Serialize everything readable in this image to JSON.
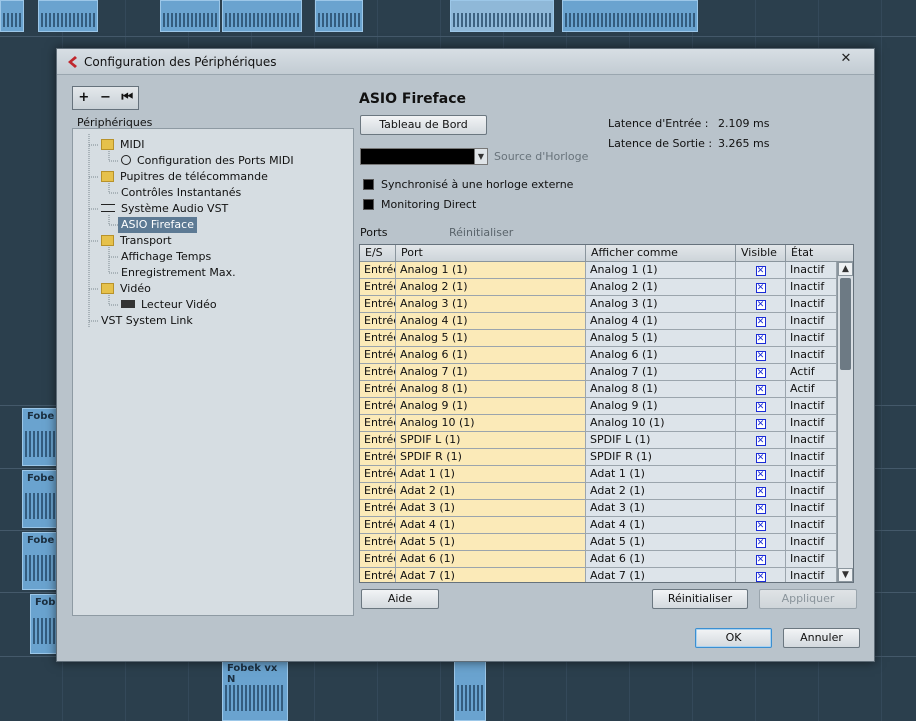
{
  "background": {
    "clip_labels": [
      "Fobe",
      "Fobe",
      "Fobe",
      "Fobe",
      "Fobek vx N"
    ]
  },
  "dialog": {
    "title": "Configuration des Périphériques",
    "close_label": "✕",
    "toolbar": {
      "add": "+",
      "remove": "−",
      "reset": "⏮"
    }
  },
  "tree": {
    "title": "Périphériques",
    "items": [
      {
        "label": "MIDI",
        "icon": "folder-icon"
      },
      {
        "label": "Configuration des Ports MIDI",
        "icon": "clock-icon"
      },
      {
        "label": "Pupitres de télécommande",
        "icon": "folder-icon"
      },
      {
        "label": "Contrôles Instantanés",
        "icon": ""
      },
      {
        "label": "Système Audio VST",
        "icon": "vst-icon"
      },
      {
        "label": "ASIO Fireface",
        "icon": ""
      },
      {
        "label": "Transport",
        "icon": "folder-icon"
      },
      {
        "label": "Affichage Temps",
        "icon": ""
      },
      {
        "label": "Enregistrement Max.",
        "icon": ""
      },
      {
        "label": "Vidéo",
        "icon": "folder-icon"
      },
      {
        "label": "Lecteur Vidéo",
        "icon": "video-icon"
      },
      {
        "label": "VST System Link",
        "icon": ""
      }
    ]
  },
  "device": {
    "title": "ASIO Fireface",
    "control_panel_button": "Tableau de Bord",
    "input_latency_label": "Latence d'Entrée :",
    "input_latency_value": "2.109 ms",
    "output_latency_label": "Latence de Sortie :",
    "output_latency_value": "3.265 ms",
    "clock_source_label": "Source d'Horloge",
    "sync_external_label": "Synchronisé à une horloge externe",
    "direct_monitoring_label": "Monitoring Direct",
    "ports_label": "Ports",
    "reset_label": "Réinitialiser"
  },
  "table": {
    "headers": {
      "io": "E/S",
      "port": "Port",
      "display": "Afficher comme",
      "visible": "Visible",
      "state": "État"
    },
    "rows": [
      {
        "io": "Entrée",
        "port": "Analog 1 (1)",
        "display": "Analog 1 (1)",
        "visible": "✕",
        "state": "Inactif"
      },
      {
        "io": "Entrée",
        "port": "Analog 2 (1)",
        "display": "Analog 2 (1)",
        "visible": "✕",
        "state": "Inactif"
      },
      {
        "io": "Entrée",
        "port": "Analog 3 (1)",
        "display": "Analog 3 (1)",
        "visible": "✕",
        "state": "Inactif"
      },
      {
        "io": "Entrée",
        "port": "Analog 4 (1)",
        "display": "Analog 4 (1)",
        "visible": "✕",
        "state": "Inactif"
      },
      {
        "io": "Entrée",
        "port": "Analog 5 (1)",
        "display": "Analog 5 (1)",
        "visible": "✕",
        "state": "Inactif"
      },
      {
        "io": "Entrée",
        "port": "Analog 6 (1)",
        "display": "Analog 6 (1)",
        "visible": "✕",
        "state": "Inactif"
      },
      {
        "io": "Entrée",
        "port": "Analog 7 (1)",
        "display": "Analog 7 (1)",
        "visible": "✕",
        "state": "Actif"
      },
      {
        "io": "Entrée",
        "port": "Analog 8 (1)",
        "display": "Analog 8 (1)",
        "visible": "✕",
        "state": "Actif"
      },
      {
        "io": "Entrée",
        "port": "Analog 9 (1)",
        "display": "Analog 9 (1)",
        "visible": "✕",
        "state": "Inactif"
      },
      {
        "io": "Entrée",
        "port": "Analog 10 (1)",
        "display": "Analog 10 (1)",
        "visible": "✕",
        "state": "Inactif"
      },
      {
        "io": "Entrée",
        "port": "SPDIF L (1)",
        "display": "SPDIF L (1)",
        "visible": "✕",
        "state": "Inactif"
      },
      {
        "io": "Entrée",
        "port": "SPDIF R (1)",
        "display": "SPDIF R (1)",
        "visible": "✕",
        "state": "Inactif"
      },
      {
        "io": "Entrée",
        "port": "Adat 1 (1)",
        "display": "Adat 1 (1)",
        "visible": "✕",
        "state": "Inactif"
      },
      {
        "io": "Entrée",
        "port": "Adat 2 (1)",
        "display": "Adat 2 (1)",
        "visible": "✕",
        "state": "Inactif"
      },
      {
        "io": "Entrée",
        "port": "Adat 3 (1)",
        "display": "Adat 3 (1)",
        "visible": "✕",
        "state": "Inactif"
      },
      {
        "io": "Entrée",
        "port": "Adat 4 (1)",
        "display": "Adat 4 (1)",
        "visible": "✕",
        "state": "Inactif"
      },
      {
        "io": "Entrée",
        "port": "Adat 5 (1)",
        "display": "Adat 5 (1)",
        "visible": "✕",
        "state": "Inactif"
      },
      {
        "io": "Entrée",
        "port": "Adat 6 (1)",
        "display": "Adat 6 (1)",
        "visible": "✕",
        "state": "Inactif"
      },
      {
        "io": "Entrée",
        "port": "Adat 7 (1)",
        "display": "Adat 7 (1)",
        "visible": "✕",
        "state": "Inactif"
      }
    ]
  },
  "buttons": {
    "help": "Aide",
    "reset": "Réinitialiser",
    "apply": "Appliquer",
    "ok": "OK",
    "cancel": "Annuler"
  }
}
